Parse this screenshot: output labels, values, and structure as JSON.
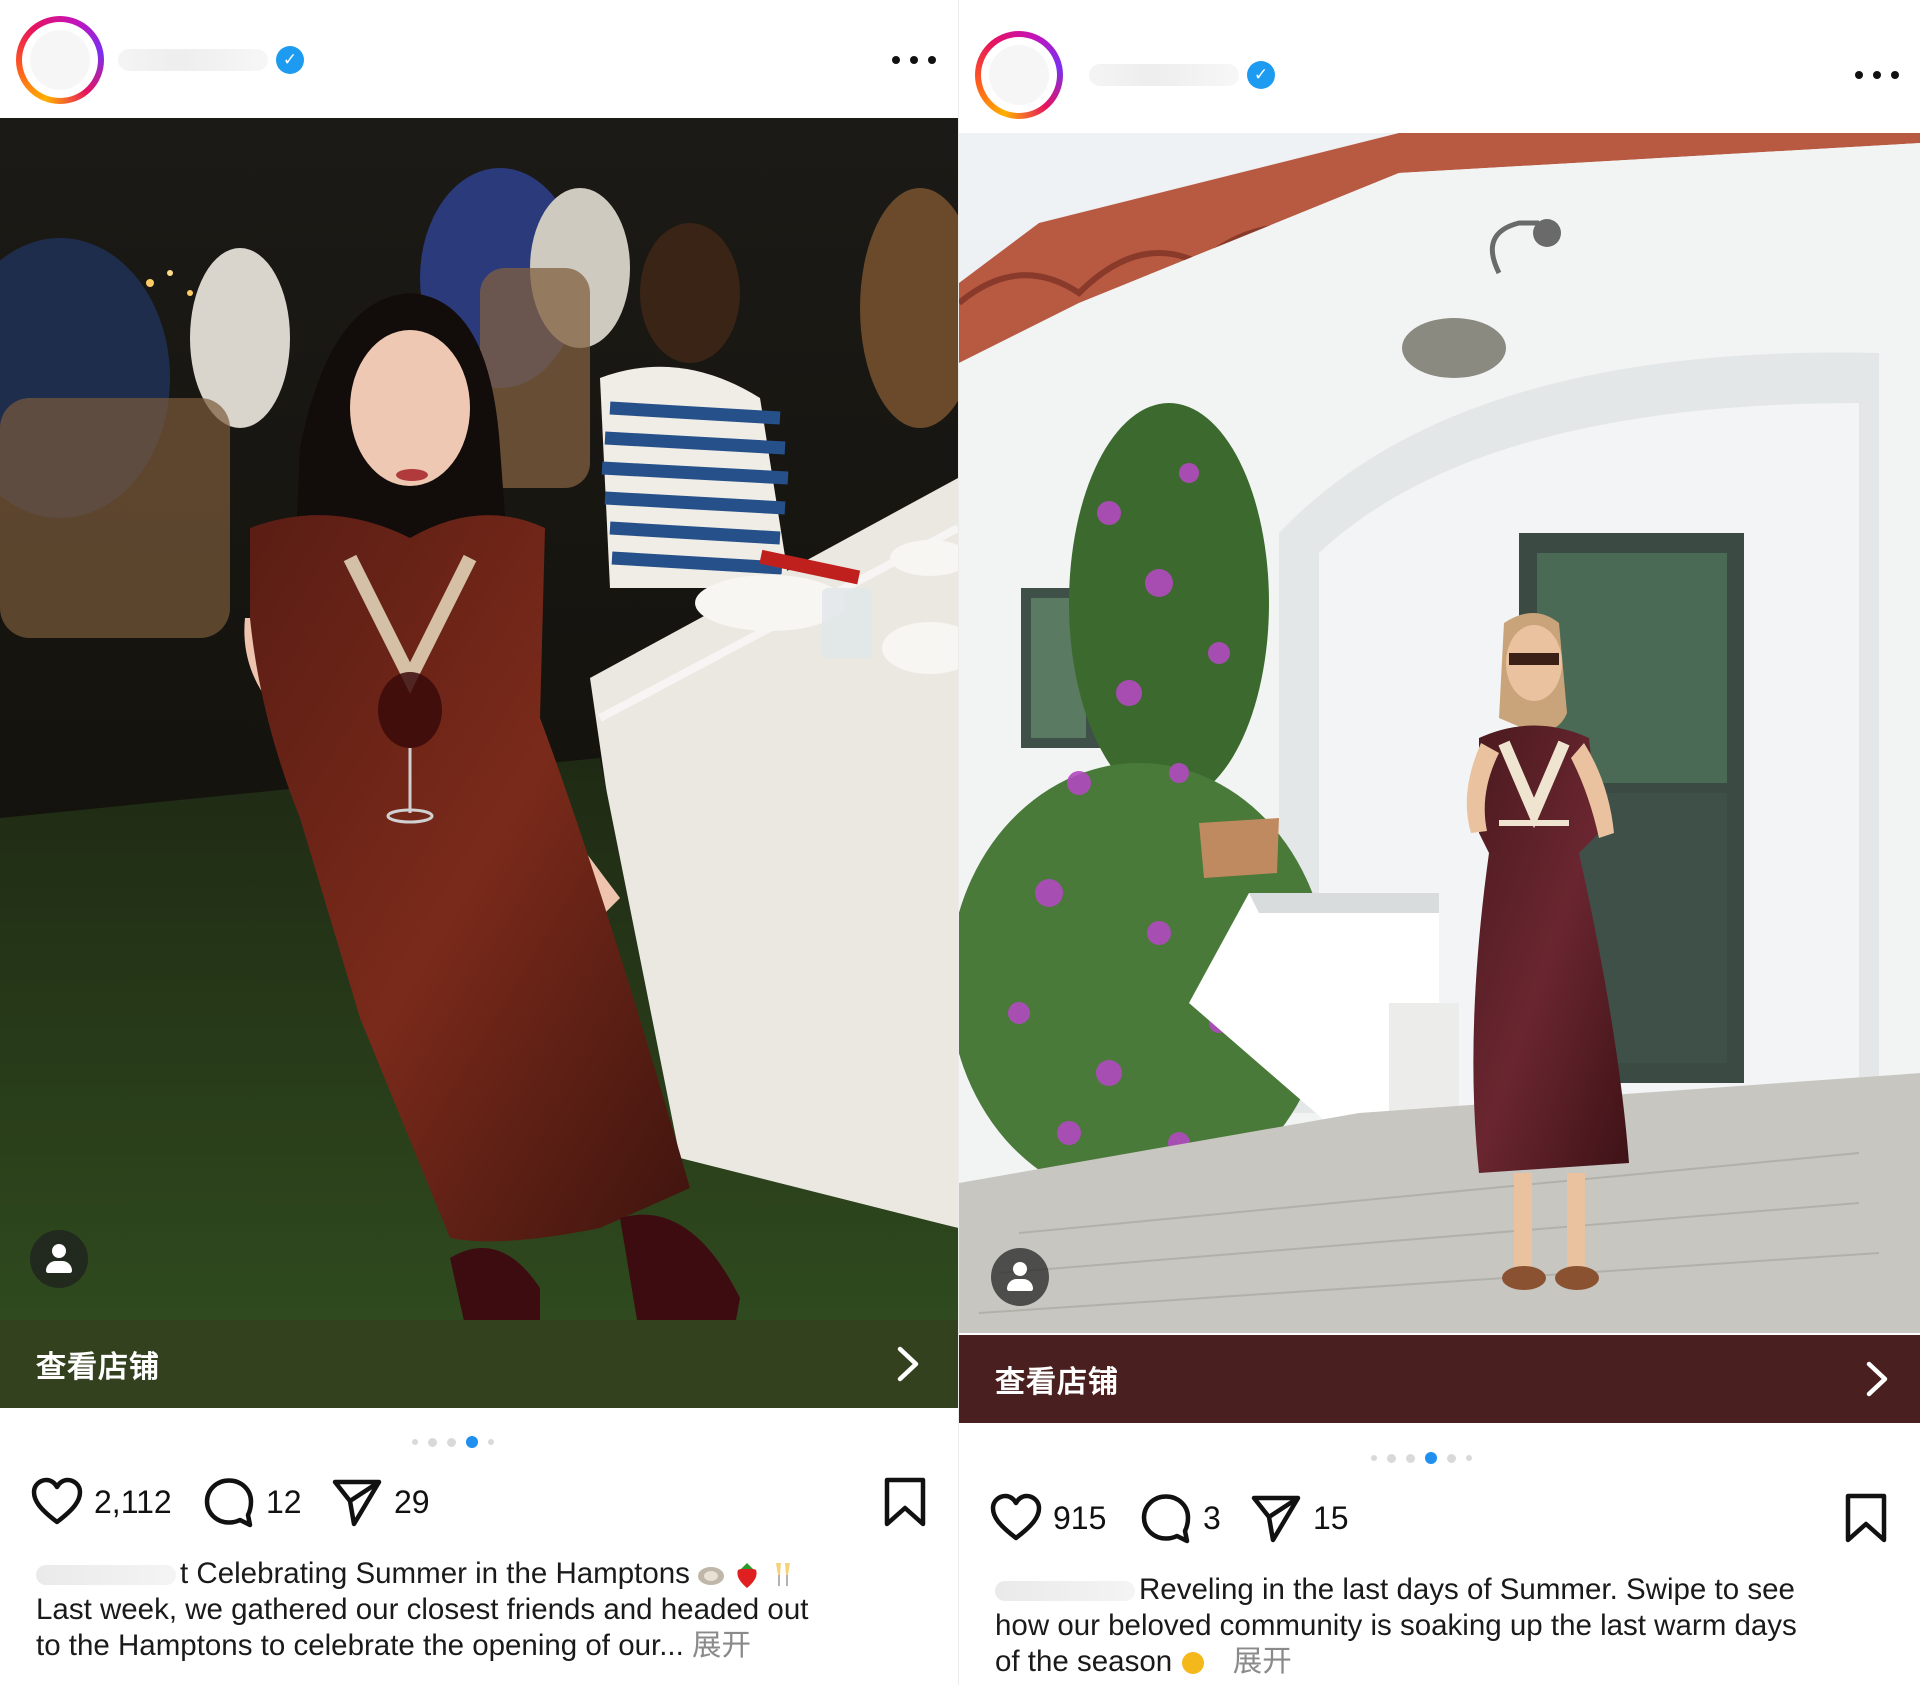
{
  "posts": [
    {
      "shop_label": "查看店铺",
      "shop_bar_color": "#33411f",
      "likes": "2,112",
      "comments": "12",
      "shares": "29",
      "carousel": {
        "count": 6,
        "active": 4
      },
      "caption": {
        "line1": "t Celebrating Summer in the Hamptons",
        "line2": "Last week, we gathered our closest friends and headed out",
        "line3": "to the Hamptons to celebrate the opening of our...",
        "more": "展开"
      },
      "icons": [
        "more-dots-icon",
        "verified-badge-icon",
        "person-tag-icon",
        "chevron-right-icon",
        "heart-icon",
        "comment-icon",
        "send-icon",
        "bookmark-icon",
        "oyster-emoji",
        "strawberry-emoji",
        "champagne-emoji"
      ]
    },
    {
      "shop_label": "查看店铺",
      "shop_bar_color": "#4a1f1f",
      "likes": "915",
      "comments": "3",
      "shares": "15",
      "carousel": {
        "count": 7,
        "active": 4
      },
      "caption": {
        "line1": "Reveling in the last days of Summer. Swipe to see",
        "line2": "how our beloved community is soaking up the last warm days",
        "line3": "of the season",
        "more": "展开"
      },
      "icons": [
        "more-dots-icon",
        "verified-badge-icon",
        "person-tag-icon",
        "chevron-right-icon",
        "heart-icon",
        "comment-icon",
        "send-icon",
        "bookmark-icon",
        "sun-emoji"
      ]
    }
  ],
  "colors": {
    "accent_blue": "#1f8ff0",
    "verified_blue": "#1d9bf0",
    "text": "#111111",
    "muted": "#8a8a8a"
  }
}
